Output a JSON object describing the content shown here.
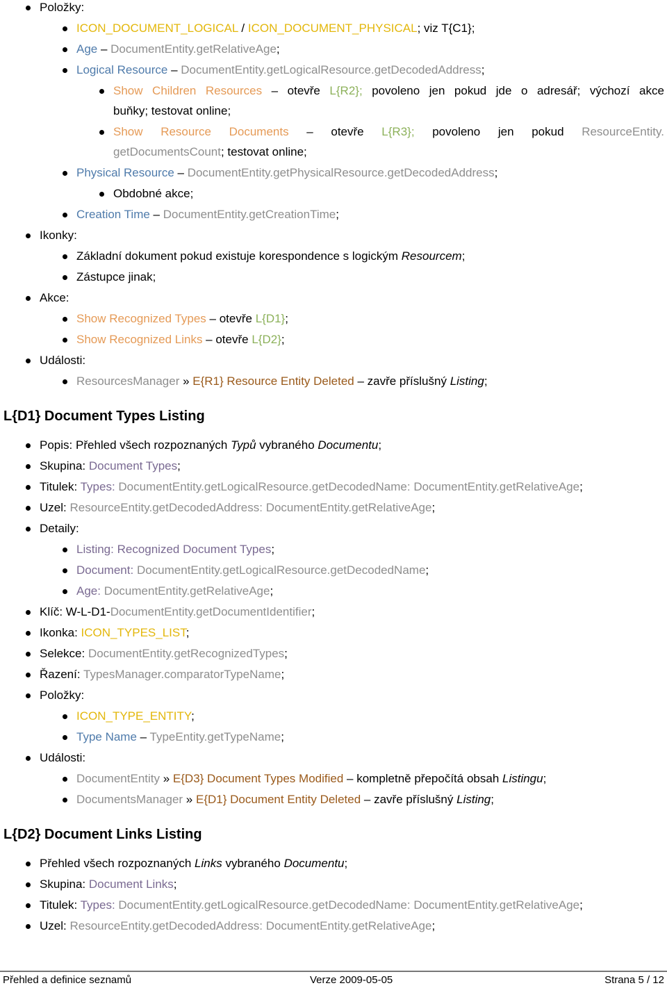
{
  "top_list": {
    "polozky_label": "Položky:",
    "items": {
      "icon_logical": "ICON_DOCUMENT_LOGICAL",
      "icon_sep": " / ",
      "icon_physical": "ICON_DOCUMENT_PHYSICAL",
      "icon_tail": "; viz T{C1};",
      "age_label": "Age",
      "dash": " – ",
      "age_value": "DocumentEntity.getRelativeAge",
      "semi": ";",
      "logical_label": "Logical Resource",
      "logical_value": "DocumentEntity.getLogicalResource.getDecodedAddress",
      "show_children_words": [
        "Show",
        "Children",
        "Resources",
        "–",
        "otevře",
        "L{R2};",
        "povoleno",
        "jen",
        "pokud",
        "jde",
        "o",
        "adresář;",
        "výchozí",
        "akce"
      ],
      "show_children_line2": "buňky; testovat online;",
      "show_res_docs_words": [
        "Show",
        "Resource",
        "Documents",
        "–",
        "otevře",
        "L{R3};",
        "povoleno",
        "jen",
        "pokud",
        "ResourceEntity."
      ],
      "show_res_docs_line2_a": "getDocumentsCount",
      "show_res_docs_line2_b": "; testovat online;",
      "physical_label": "Physical Resource",
      "physical_value": "DocumentEntity.getPhysicalResource.getDecodedAddress",
      "obdobne": "Obdobné akce;",
      "creation_label": "Creation Time",
      "creation_value": "DocumentEntity.getCreationTime"
    },
    "ikonky_label": "Ikonky:",
    "ikonky": {
      "item1_a": "Základní dokument pokud existuje korespondence s logickým ",
      "item1_b": "Resourcem",
      "item1_c": ";",
      "item2": "Zástupce jinak;"
    },
    "akce_label": "Akce:",
    "akce": {
      "types_label": "Show Recognized Types",
      "links_label": "Show Recognized Links",
      "opens": " – otevře ",
      "types_target": "L{D1}",
      "links_target": "L{D2}",
      "semi": ";"
    },
    "udalosti_label": "Události:",
    "udalosti": {
      "source": "ResourcesManager",
      "arrow": " » ",
      "event": "E{R1} Resource Entity Deleted",
      "text": " – zavře příslušný ",
      "listing": "Listing",
      "semi": ";"
    }
  },
  "section_d1": {
    "title": "L{D1} Document Types Listing",
    "popis_label": "Popis: ",
    "popis_a": "Přehled všech rozpoznaných ",
    "popis_b": "Typů",
    "popis_c": " vybraného ",
    "popis_d": "Documentu",
    "popis_e": ";",
    "skupina_label": "Skupina: ",
    "skupina_value": "Document Types",
    "titulek_label": "Titulek: ",
    "titulek_types": "Types: ",
    "titulek_value": "DocumentEntity.getLogicalResource.getDecodedName: DocumentEntity.getRelativeAge",
    "uzel_label": "Uzel: ",
    "uzel_value": "ResourceEntity.getDecodedAddress: DocumentEntity.getRelativeAge",
    "detaily_label": "Detaily:",
    "detaily": {
      "listing": "Listing: Recognized Document Types",
      "document_label": "Document: ",
      "document_value": "DocumentEntity.getLogicalResource.getDecodedName",
      "age_label": "Age: ",
      "age_value": "DocumentEntity.getRelativeAge"
    },
    "klic_label": "Klíč: W-L-D1-",
    "klic_value": "DocumentEntity.getDocumentIdentifier",
    "ikonka_label": "Ikonka: ",
    "ikonka_value": "ICON_TYPES_LIST",
    "selekce_label": "Selekce: ",
    "selekce_value": "DocumentEntity.getRecognizedTypes",
    "razeni_label": "Řazení: ",
    "razeni_value": "TypesManager.comparatorTypeName",
    "polozky_label": "Položky:",
    "polozky": {
      "icon": "ICON_TYPE_ENTITY",
      "type_name_label": "Type Name",
      "type_name_value": "TypeEntity.getTypeName"
    },
    "udalosti_label": "Události:",
    "udalosti": [
      {
        "source": "DocumentEntity",
        "event": "E{D3} Document Types Modified",
        "text": " – kompletně přepočítá obsah ",
        "listing": "Listingu"
      },
      {
        "source": "DocumentsManager",
        "event": "E{D1} Document Entity Deleted",
        "text": " – zavře příslušný ",
        "listing": "Listing"
      }
    ]
  },
  "section_d2": {
    "title": "L{D2} Document Links Listing",
    "popis_a": "Přehled všech rozpoznaných ",
    "popis_b": "Links",
    "popis_c": " vybraného ",
    "popis_d": "Documentu",
    "popis_e": ";",
    "skupina_label": "Skupina: ",
    "skupina_value": "Document Links",
    "titulek_label": "Titulek: ",
    "titulek_types": "Types: ",
    "titulek_value": "DocumentEntity.getLogicalResource.getDecodedName: DocumentEntity.getRelativeAge",
    "uzel_label": "Uzel: ",
    "uzel_value": "ResourceEntity.getDecodedAddress: DocumentEntity.getRelativeAge"
  },
  "common": {
    "arrow": " » ",
    "dash": " – ",
    "semi": ";"
  },
  "footer": {
    "left": "Přehled a definice seznamů",
    "center": "Verze 2009-05-05",
    "right": "Strana 5 / 12"
  }
}
